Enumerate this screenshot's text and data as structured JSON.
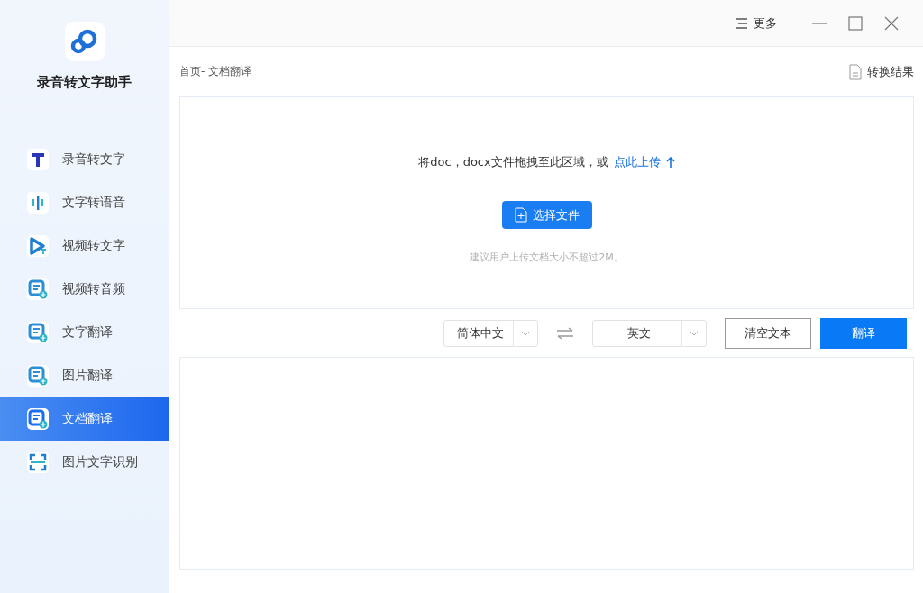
{
  "app": {
    "name": "录音转文字助手"
  },
  "sidebar": {
    "items": [
      {
        "label": "录音转文字",
        "selected": false
      },
      {
        "label": "文字转语音",
        "selected": false
      },
      {
        "label": "视频转文字",
        "selected": false
      },
      {
        "label": "视频转音频",
        "selected": false
      },
      {
        "label": "文字翻译",
        "selected": false
      },
      {
        "label": "图片翻译",
        "selected": false
      },
      {
        "label": "文档翻译",
        "selected": true
      },
      {
        "label": "图片文字识别",
        "selected": false
      }
    ]
  },
  "titlebar": {
    "more": "更多"
  },
  "breadcrumb": "首页- 文档翻译",
  "results_link": "转换结果",
  "upload": {
    "hint": "将doc，docx文件拖拽至此区域，或",
    "link": "点此上传",
    "button": "选择文件",
    "note": "建议用户上传文档大小不超过2M。"
  },
  "controls": {
    "source_language": "简体中文",
    "target_language": "英文",
    "clear_button": "清空文本",
    "translate_button": "翻译"
  }
}
